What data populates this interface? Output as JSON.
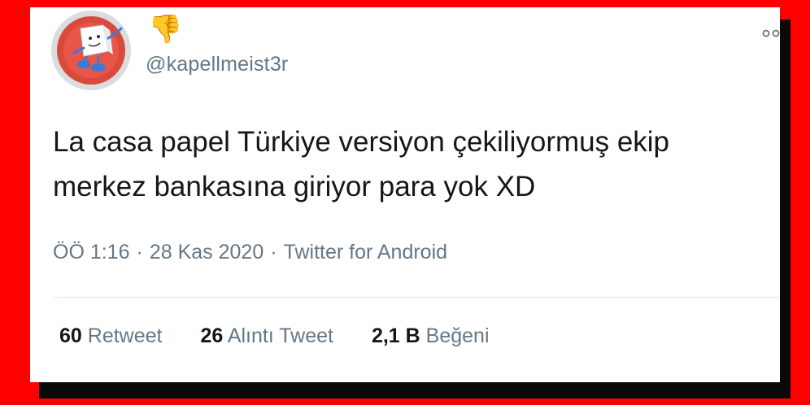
{
  "tweet": {
    "emoji": "👎",
    "handle": "@kapellmeist3r",
    "text": "La casa papel Türkiye versiyon çekiliyormuş ekip merkez bankasına giriyor para yok XD",
    "time": "ÖÖ 1:16",
    "date": "28 Kas 2020",
    "source": "Twitter for Android",
    "separator": "·"
  },
  "stats": [
    {
      "count": "60",
      "label": "Retweet"
    },
    {
      "count": "26",
      "label": "Alıntı Tweet"
    },
    {
      "count": "2,1 B",
      "label": "Beğeni"
    }
  ],
  "colors": {
    "frame": "#ff0000",
    "muted": "#657786",
    "text": "#14171a",
    "divider": "#e1e8ed"
  },
  "icons": {
    "more": "more-options-icon",
    "avatar": "avatar-image"
  }
}
